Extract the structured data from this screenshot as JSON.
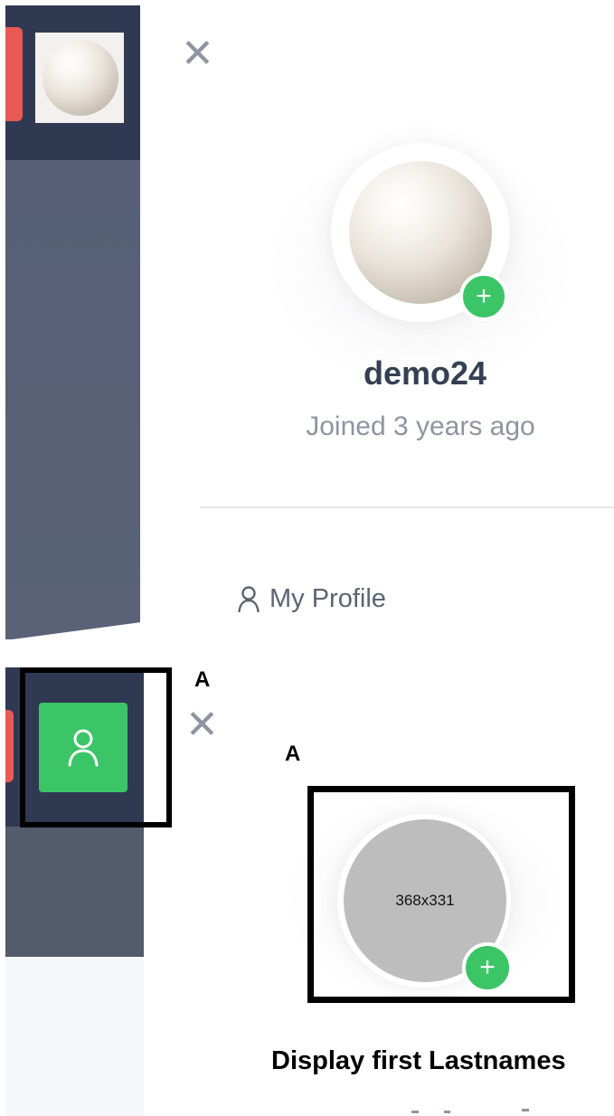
{
  "top_panel": {
    "close_icon": "close-icon",
    "username": "demo24",
    "joined": "Joined 3 years ago",
    "add_photo_icon": "+",
    "menu": [
      {
        "icon": "user-icon",
        "label": "My Profile"
      }
    ],
    "colors": {
      "sidebar": "#2f3a52",
      "accent_green": "#3cc567",
      "close_button": "#ea5a55"
    }
  },
  "bottom_panel": {
    "annotation_sidebar": "A",
    "annotation_avatar": "A",
    "avatar_placeholder": "368x331",
    "add_photo_icon": "+",
    "display_name": "Display first Lastnames"
  }
}
